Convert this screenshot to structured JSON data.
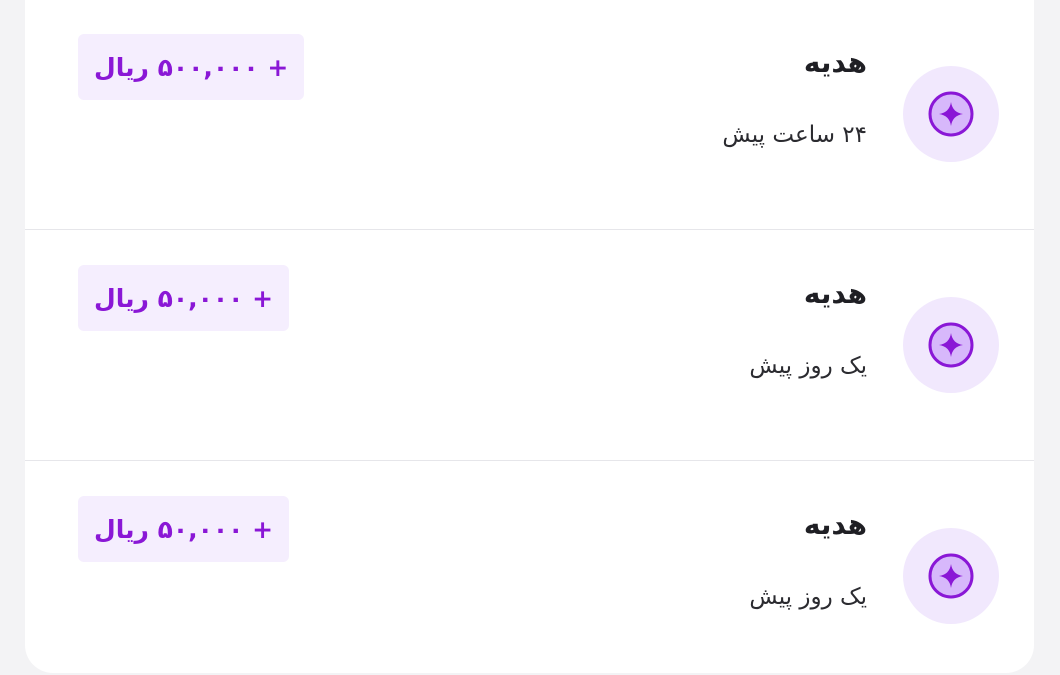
{
  "colors": {
    "accent": "#8a17d6",
    "icon_bg": "#f1e8fd",
    "badge_bg": "#f5eefe"
  },
  "transactions": [
    {
      "icon": "sparkle-icon",
      "title": "هدیه",
      "time": "۲۴ ساعت پیش",
      "amount": "+ ۵۰۰,۰۰۰ ریال"
    },
    {
      "icon": "sparkle-icon",
      "title": "هدیه",
      "time": "یک روز پیش",
      "amount": "+ ۵۰,۰۰۰ ریال"
    },
    {
      "icon": "sparkle-icon",
      "title": "هدیه",
      "time": "یک روز پیش",
      "amount": "+ ۵۰,۰۰۰ ریال"
    }
  ]
}
